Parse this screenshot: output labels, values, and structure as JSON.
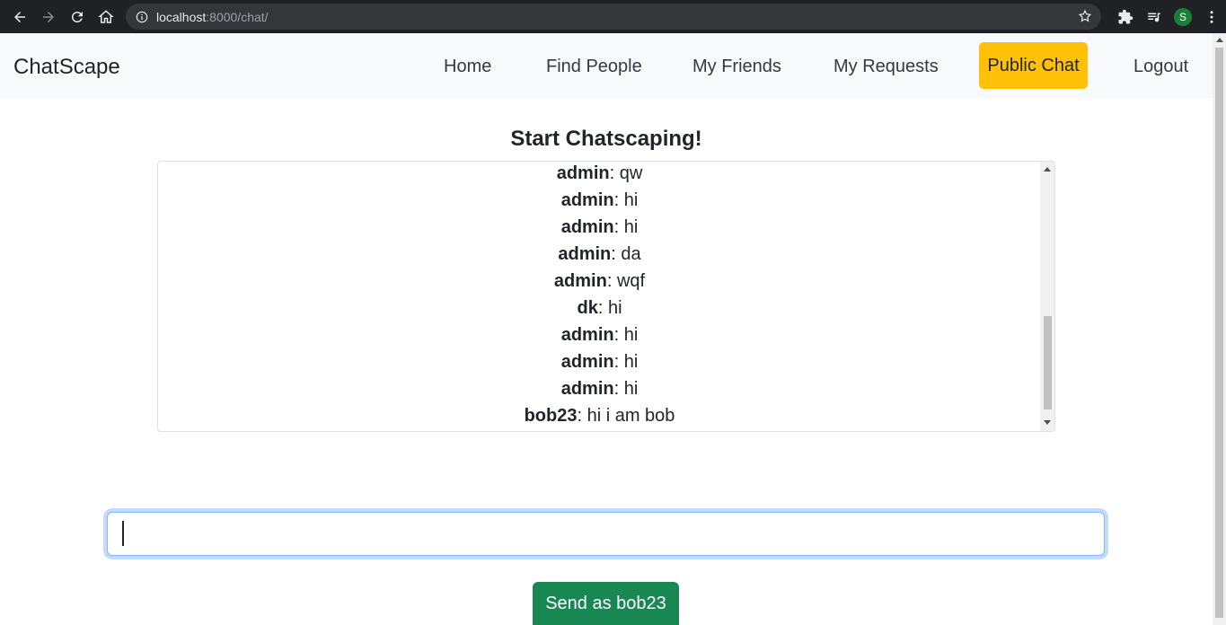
{
  "browser": {
    "url_host": "localhost",
    "url_rest": ":8000/chat/",
    "profile_initial": "S"
  },
  "navbar": {
    "brand": "ChatScape",
    "links": [
      "Home",
      "Find People",
      "My Friends",
      "My Requests",
      "Public Chat",
      "Logout"
    ],
    "active": "Public Chat",
    "active_color": "#ffc107"
  },
  "main": {
    "heading": "Start Chatscaping!",
    "messages": [
      {
        "user": "admin",
        "text": ": qw"
      },
      {
        "user": "admin",
        "text": ": hi"
      },
      {
        "user": "admin",
        "text": ": hi"
      },
      {
        "user": "admin",
        "text": ": da"
      },
      {
        "user": "admin",
        "text": ": wqf"
      },
      {
        "user": "dk",
        "text": ": hi"
      },
      {
        "user": "admin",
        "text": ": hi"
      },
      {
        "user": "admin",
        "text": ": hi"
      },
      {
        "user": "admin",
        "text": ": hi"
      },
      {
        "user": "bob23",
        "text": ": hi i am bob"
      }
    ],
    "input_value": "",
    "send_label": "Send as bob23",
    "send_color": "#198754"
  }
}
